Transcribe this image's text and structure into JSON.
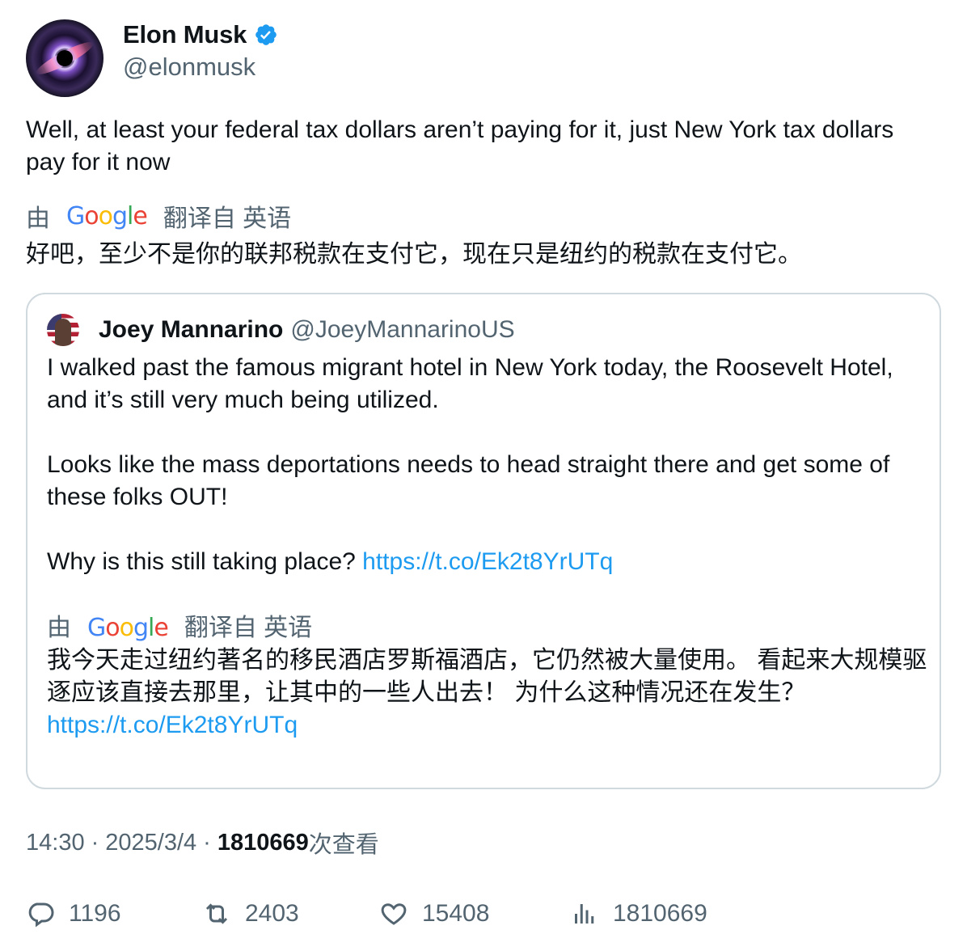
{
  "author": {
    "display_name": "Elon Musk",
    "handle": "@elonmusk",
    "verified_icon": "verified-badge-icon"
  },
  "tweet": {
    "text": "Well, at least your federal tax dollars aren’t paying for it, just New York tax dollars pay for it now",
    "translation": {
      "prefix": "由",
      "suffix": "翻译自 英语",
      "text": "好吧，至少不是你的联邦税款在支付它，现在只是纽约的税款在支付它。"
    }
  },
  "quote": {
    "display_name": "Joey Mannarino",
    "handle": "@JoeyMannarinoUS",
    "paragraph1": "I walked past the famous migrant hotel in New York today, the Roosevelt Hotel, and it’s still very much being utilized.",
    "paragraph2": "Looks like the mass deportations needs to head straight there and get some of these folks OUT!",
    "paragraph3_text": "Why is this still taking place? ",
    "link": "https://t.co/Ek2t8YrUTq",
    "translation": {
      "prefix": "由",
      "suffix": "翻译自 英语",
      "text": "我今天走过纽约著名的移民酒店罗斯福酒店，它仍然被大量使用。 看起来大规模驱逐应该直接去那里，让其中的一些人出去！ 为什么这种情况还在发生？",
      "link": "https://t.co/Ek2t8YrUTq"
    }
  },
  "meta": {
    "time": "14:30",
    "separator": "·",
    "date": "2025/3/4",
    "views_count": "1810669",
    "views_label": "次查看"
  },
  "actions": {
    "replies": "1196",
    "retweets": "2403",
    "likes": "15408",
    "views": "1810669"
  },
  "colors": {
    "link": "#1d9bf0",
    "secondary_text": "#536471",
    "verified": "#1d9bf0"
  }
}
